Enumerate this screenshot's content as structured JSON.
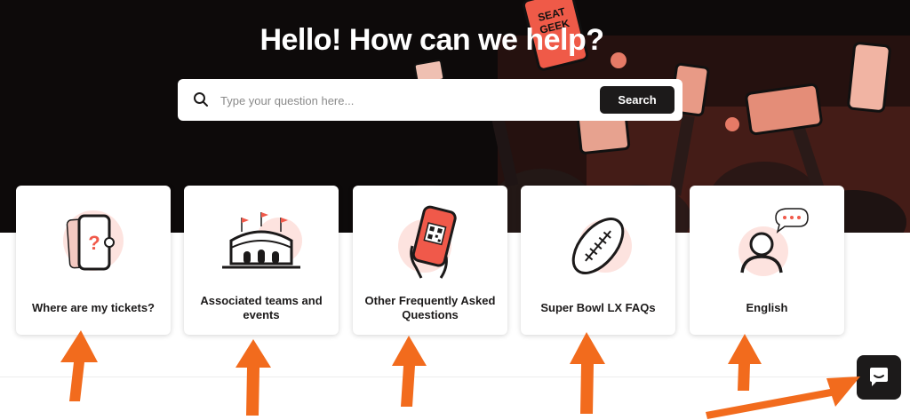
{
  "hero": {
    "title": "Hello! How can we help?",
    "brand_sign": [
      "SEAT",
      "GEEK"
    ]
  },
  "search": {
    "placeholder": "Type your question here...",
    "button_label": "Search"
  },
  "categories": [
    {
      "label": "Where are my tickets?",
      "icon": "ticket-question-icon"
    },
    {
      "label": "Associated teams and events",
      "icon": "stadium-icon"
    },
    {
      "label": "Other Frequently Asked Questions",
      "icon": "phone-qr-icon"
    },
    {
      "label": "Super Bowl LX FAQs",
      "icon": "football-icon"
    },
    {
      "label": "English",
      "icon": "user-chat-icon"
    }
  ],
  "chat": {
    "icon": "chat-bubble-icon"
  },
  "colors": {
    "accent": "#f0594a",
    "dark": "#1c1a1a",
    "annotation_arrow": "#f26b1d"
  }
}
